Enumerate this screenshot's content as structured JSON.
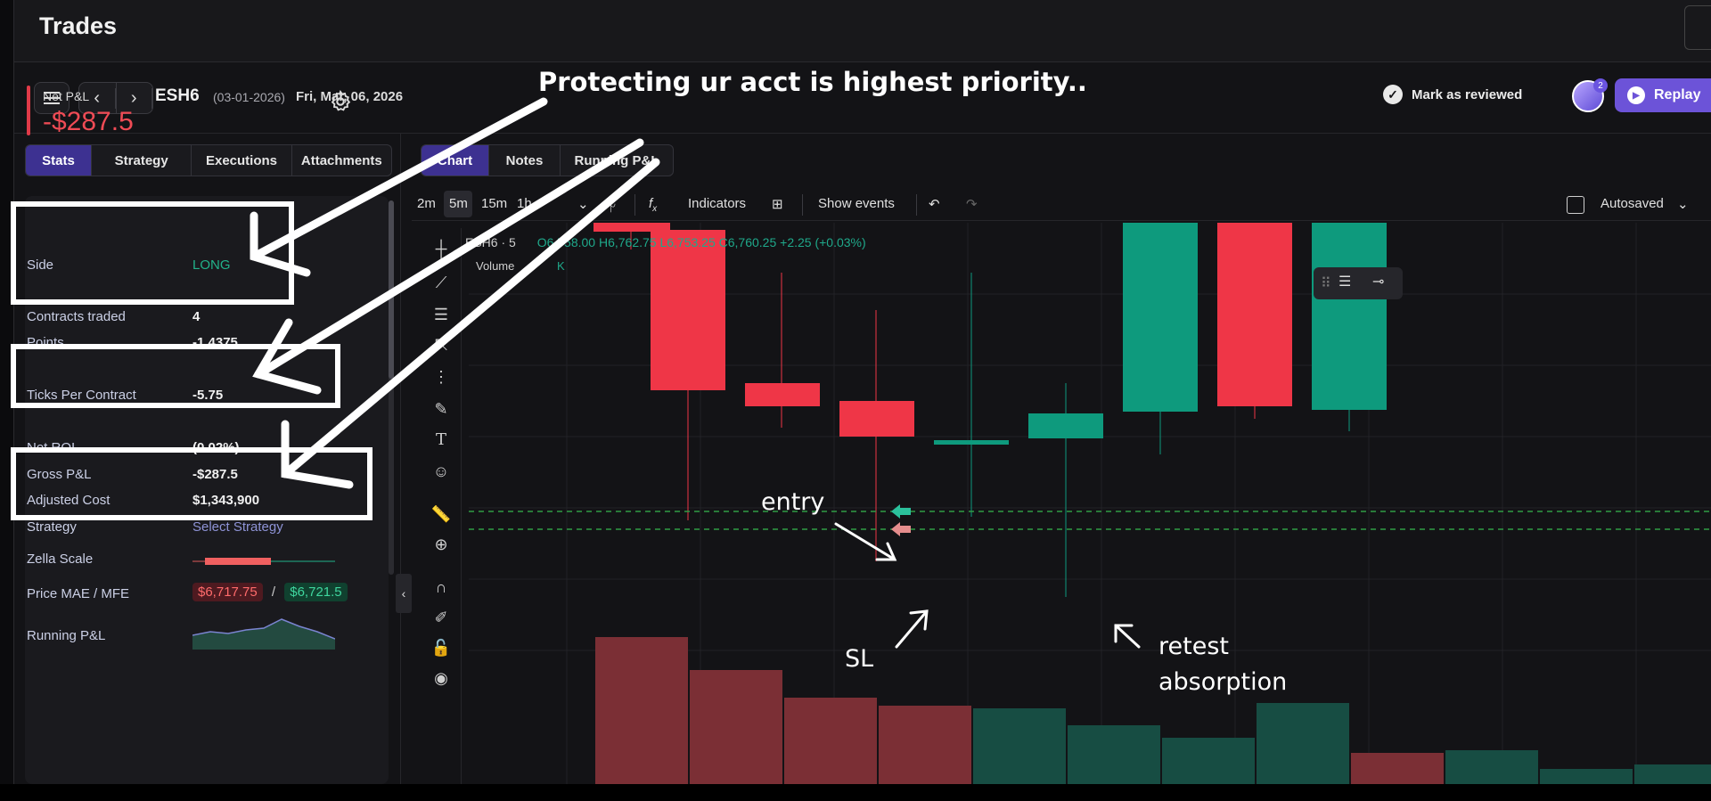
{
  "window": {
    "title": "Trades"
  },
  "header": {
    "symbol": "ESH6",
    "contract_date": "(03-01-2026)",
    "trade_date": "Fri, Mar, 06, 2026",
    "mark_reviewed": "Mark as reviewed",
    "avatar_badge": "2",
    "replay": "Replay"
  },
  "left_tabs": [
    "Stats",
    "Strategy",
    "Executions",
    "Attachments"
  ],
  "stats": {
    "net_pnl_label": "Net P&L",
    "net_pnl_value": "-$287.5",
    "rows": [
      {
        "label": "Side",
        "value": "LONG"
      },
      {
        "label": "Contracts traded",
        "value": "4"
      },
      {
        "label": "Points",
        "value": "-1.4375"
      },
      {
        "label": "Ticks Per Contract",
        "value": "-5.75"
      },
      {
        "label": "Net ROI",
        "value": "(0.02%)"
      },
      {
        "label": "Gross P&L",
        "value": "-$287.5"
      },
      {
        "label": "Adjusted Cost",
        "value": "$1,343,900"
      },
      {
        "label": "Strategy",
        "value": "Select Strategy"
      },
      {
        "label": "Zella Scale",
        "value": ""
      },
      {
        "label": "Price MAE / MFE",
        "mae": "$6,717.75",
        "sep": "/",
        "mfe": "$6,721.5"
      },
      {
        "label": "Running P&L",
        "value": ""
      }
    ]
  },
  "chart_tabs": [
    "Chart",
    "Notes",
    "Running P&L"
  ],
  "toolbar": {
    "timeframes": [
      "2m",
      "5m",
      "15m",
      "1h"
    ],
    "active_timeframe": "5m",
    "indicators": "Indicators",
    "show_events": "Show events",
    "autosaved": "Autosaved"
  },
  "chart_legend": {
    "title": "ESH6 · 5",
    "ohlc": "O6,758.00 H6,762.75 L6,753.25 C6,760.25 +2.25 (+0.03%)",
    "volume_label": "Volume",
    "volume_value": "K"
  },
  "annotations": {
    "headline": "Protecting ur acct  is highest priority..",
    "entry": "entry",
    "sl": "SL",
    "retest": "retest",
    "absorption": "absorption"
  },
  "colors": {
    "accent": "#3d3191",
    "replay": "#6c53d8",
    "bull": "#0e9a7d",
    "bear": "#ef3647",
    "loss": "#ef4b55",
    "gain": "#22b28a"
  }
}
